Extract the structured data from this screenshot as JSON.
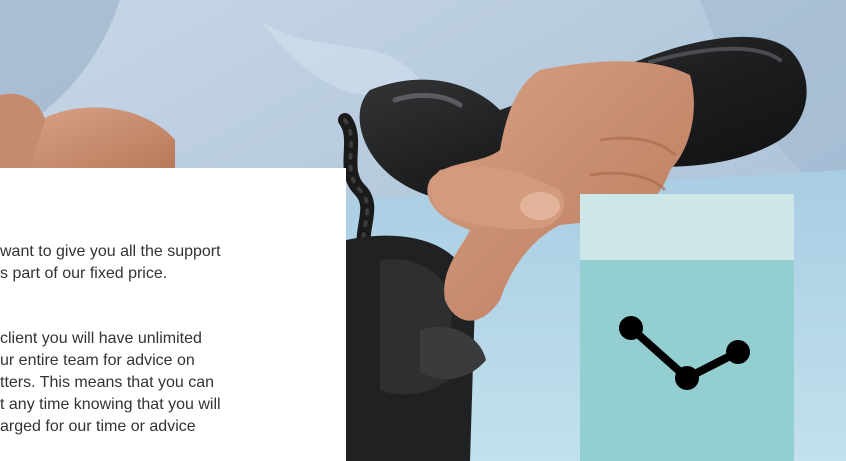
{
  "colors": {
    "panel_background": "#ffffff",
    "body_text": "#333333",
    "card_top": "#cde6e8",
    "card_body": "#93cfd0",
    "icon": "#000000"
  },
  "hero": {
    "image_subject": "person holding a black telephone handset"
  },
  "content": {
    "paragraph_1": [
      "want to give you all the support",
      "s part of our fixed price."
    ],
    "paragraph_2": [
      "client you will have unlimited",
      "ur entire team for advice on",
      "tters. This means that you can",
      "t any time knowing that you will",
      "arged for our time or advice"
    ]
  },
  "card": {
    "icon": "trend-line-icon"
  }
}
